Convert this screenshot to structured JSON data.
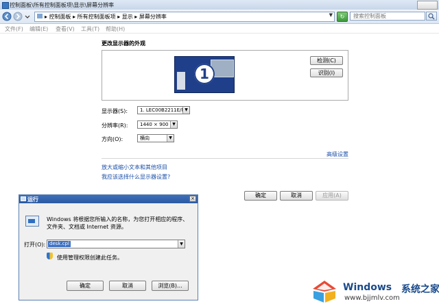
{
  "window": {
    "title": "控制面板\\所有控制面板项\\显示\\屏幕分辨率"
  },
  "address": {
    "path": "▸ 控制面板 ▸ 所有控制面板项 ▸ 显示 ▸ 屏幕分辨率",
    "refresh_glyph": "↻",
    "search_placeholder": "搜索控制面板"
  },
  "menu": [
    "文件(F)",
    "编辑(E)",
    "查看(V)",
    "工具(T)",
    "帮助(H)"
  ],
  "main": {
    "heading": "更改显示器的外观",
    "monitor_number": "1",
    "detect_label": "检测(C)",
    "identify_label": "识别(I)",
    "display_label": "显示器(S):",
    "display_value": "1. LEC00B2211E/M",
    "resolution_label": "分辨率(R):",
    "resolution_value": "1440 × 900",
    "orientation_label": "方向(O):",
    "orientation_value": "横向",
    "advanced_link": "高级设置",
    "link_text_size": "放大或缩小文本和其他项目",
    "link_which_settings": "我应该选择什么显示器设置?",
    "ok_label": "确定",
    "cancel_label": "取消",
    "apply_label": "应用(A)"
  },
  "run_dialog": {
    "title": "运行",
    "close_glyph": "×",
    "description": "Windows 将根据您所输入的名称，为您打开相应的程序、文件夹、文档或 Internet 资源。",
    "open_label": "打开(O):",
    "open_value": "desk.cpl",
    "admin_text": "使用管理权限创建此任务。",
    "ok_label": "确定",
    "cancel_label": "取消",
    "browse_label": "浏览(B)..."
  },
  "watermark": {
    "brand": "Windows",
    "brand_suffix": "系统之家",
    "url": "www.bjjmlv.com"
  },
  "colors": {
    "link": "#1a4fa8",
    "monitor": "#1f3f8a",
    "run_titlebar": "#2a59a2"
  }
}
